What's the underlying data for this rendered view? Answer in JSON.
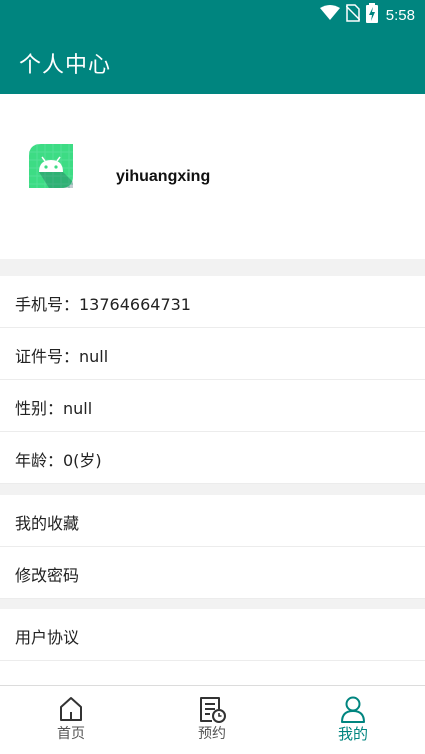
{
  "status_bar": {
    "time": "5:58"
  },
  "header": {
    "title": "个人中心"
  },
  "profile": {
    "username": "yihuangxing"
  },
  "info": [
    {
      "label": "手机号：13764664731"
    },
    {
      "label": "证件号：null"
    },
    {
      "label": "性别：null"
    },
    {
      "label": "年龄：0(岁)"
    }
  ],
  "menu": [
    {
      "label": "我的收藏"
    },
    {
      "label": "修改密码"
    },
    {
      "label": "用户协议"
    }
  ],
  "nav": [
    {
      "label": "首页",
      "icon": "home-icon"
    },
    {
      "label": "预约",
      "icon": "appointment-icon"
    },
    {
      "label": "我的",
      "icon": "profile-icon",
      "active": true
    }
  ],
  "colors": {
    "primary": "#00857f",
    "background": "#f2f2f2"
  }
}
